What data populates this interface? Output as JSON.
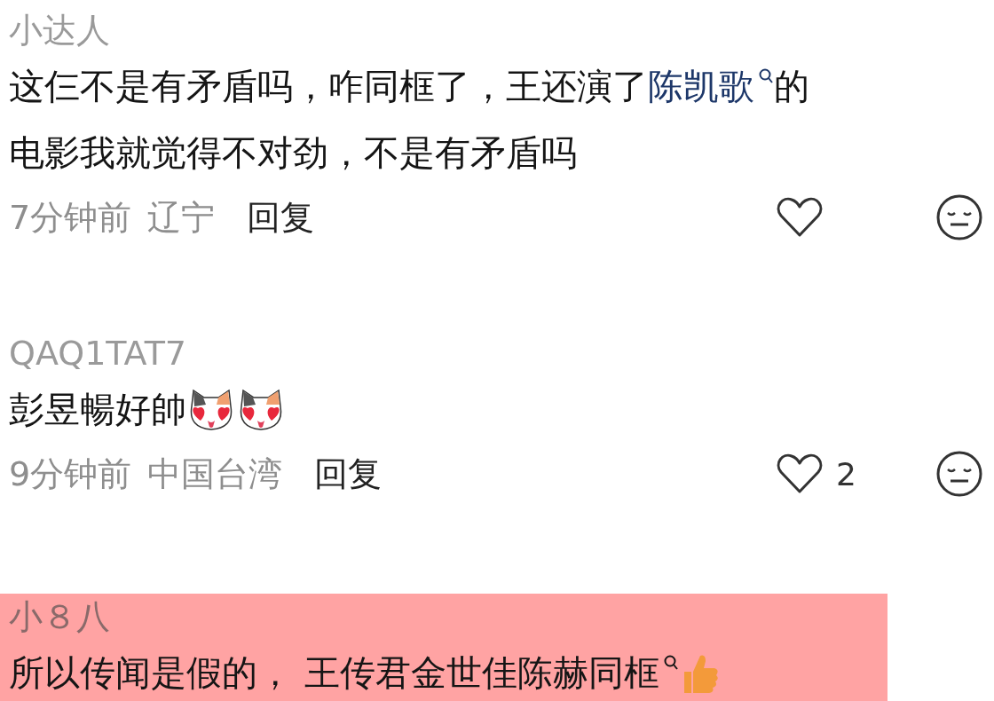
{
  "comments": [
    {
      "username": "小达人",
      "highlighted": false,
      "lines": [
        [
          {
            "kind": "text",
            "text": "这仨不是有矛盾吗，咋同框了，王还演了 "
          },
          {
            "kind": "link",
            "text": "陈凯歌"
          },
          {
            "kind": "text",
            "text": " 的"
          }
        ],
        [
          {
            "kind": "text",
            "text": "电影我就觉得不对劲，不是有矛盾吗"
          }
        ]
      ],
      "meta": {
        "time": "7分钟前",
        "location": "辽宁",
        "reply": "回复"
      }
    },
    {
      "username": "QAQ1TAT7",
      "highlighted": false,
      "lines": [
        [
          {
            "kind": "text",
            "text": "彭昱暢好帥"
          },
          {
            "kind": "cat"
          },
          {
            "kind": "cat"
          }
        ]
      ],
      "meta": {
        "time": "9分钟前",
        "location": "中国台湾",
        "reply": "回复",
        "likes": "2"
      }
    },
    {
      "username": "小８八",
      "highlighted": true,
      "lines": [
        [
          {
            "kind": "text",
            "text": "所以传闻是假的，  王传君金世佳陈赫"
          },
          {
            "kind": "keyword",
            "text": "同框"
          },
          {
            "kind": "thumb"
          }
        ]
      ]
    }
  ]
}
